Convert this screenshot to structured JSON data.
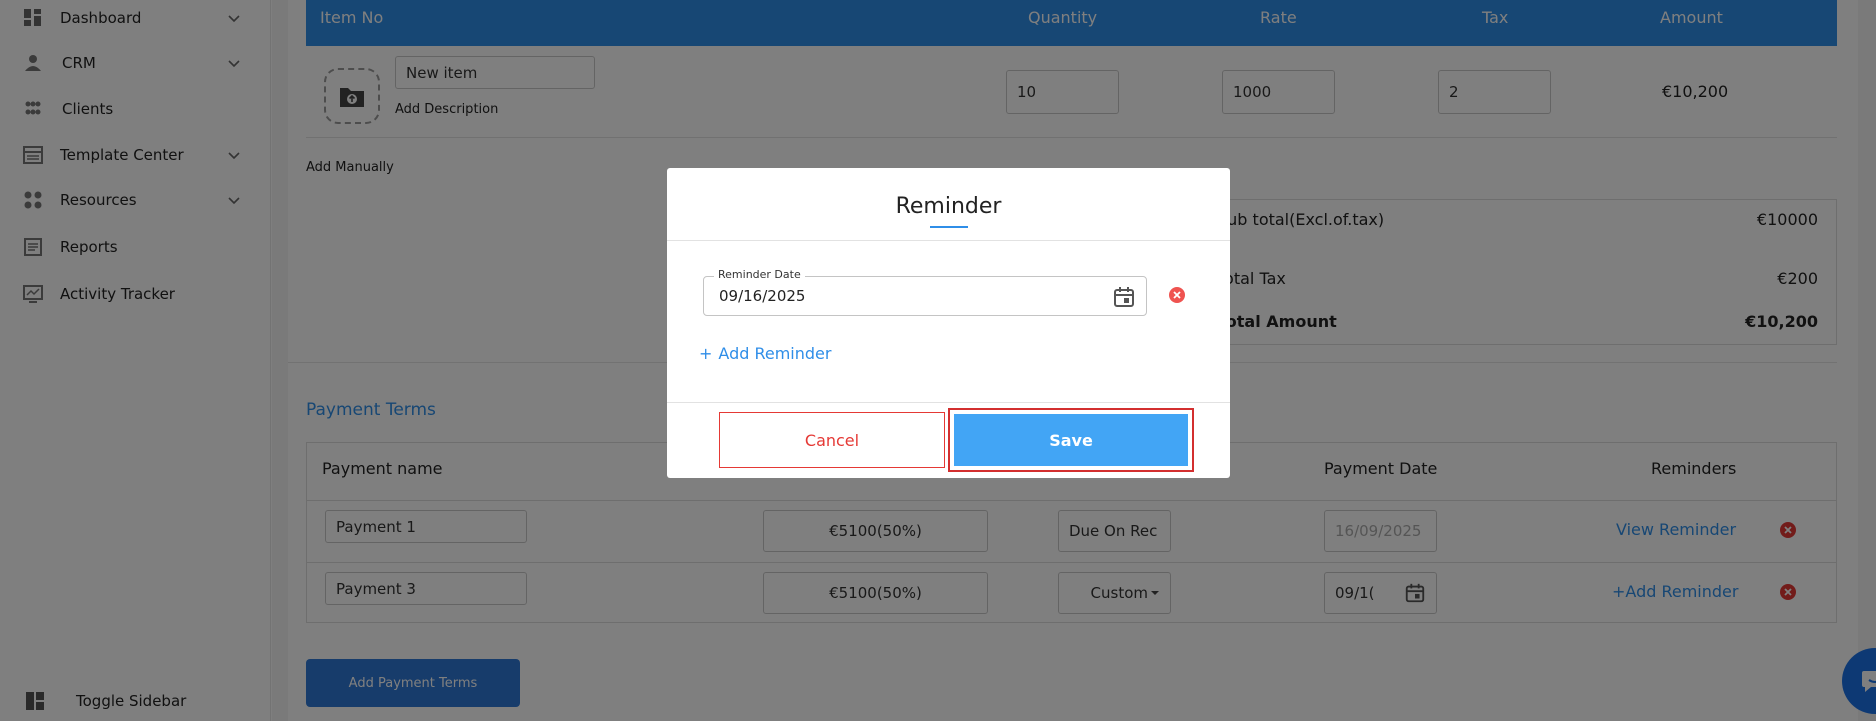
{
  "sidebar": {
    "items": [
      {
        "label": "Dashboard",
        "icon": "dashboard-icon",
        "expandable": true
      },
      {
        "label": "CRM",
        "icon": "crm-icon",
        "expandable": true
      },
      {
        "label": "Clients",
        "icon": "clients-icon",
        "expandable": false
      },
      {
        "label": "Template Center",
        "icon": "template-icon",
        "expandable": true
      },
      {
        "label": "Resources",
        "icon": "resources-icon",
        "expandable": true
      },
      {
        "label": "Reports",
        "icon": "reports-icon",
        "expandable": false
      },
      {
        "label": "Activity Tracker",
        "icon": "activity-icon",
        "expandable": false
      }
    ],
    "toggle_label": "Toggle Sidebar"
  },
  "items_table": {
    "headers": {
      "item_no": "Item No",
      "quantity": "Quantity",
      "rate": "Rate",
      "tax": "Tax",
      "amount": "Amount"
    },
    "row": {
      "name": "New item",
      "add_description": "Add Description",
      "quantity": "10",
      "rate": "1000",
      "tax": "2",
      "amount": "€10,200"
    },
    "add_manually": "Add Manually"
  },
  "totals": {
    "subtotal_label": "Sub total(Excl.of.tax)",
    "subtotal_value": "€10000",
    "tax_label": "Total Tax",
    "tax_value": "€200",
    "total_label": "Total Amount",
    "total_value": "€10,200"
  },
  "payment_terms": {
    "title": "Payment Terms",
    "headers": {
      "name": "Payment name",
      "date": "Payment Date",
      "reminders": "Reminders"
    },
    "rows": [
      {
        "name": "Payment 1",
        "amount": "€5100(50%)",
        "type": "Due On Rec",
        "date": "16/09/2025",
        "reminder": "View Reminder"
      },
      {
        "name": "Payment 3",
        "amount": "€5100(50%)",
        "type": "Custom",
        "date": "09/1(",
        "reminder": "+Add Reminder"
      }
    ],
    "add_button": "Add Payment Terms"
  },
  "modal": {
    "title": "Reminder",
    "date_label": "Reminder Date",
    "date_value": "09/16/2025",
    "add_reminder": "Add Reminder",
    "cancel": "Cancel",
    "save": "Save"
  },
  "colors": {
    "accent": "#2f8ee8",
    "danger": "#e53935",
    "save": "#42a5f5"
  }
}
